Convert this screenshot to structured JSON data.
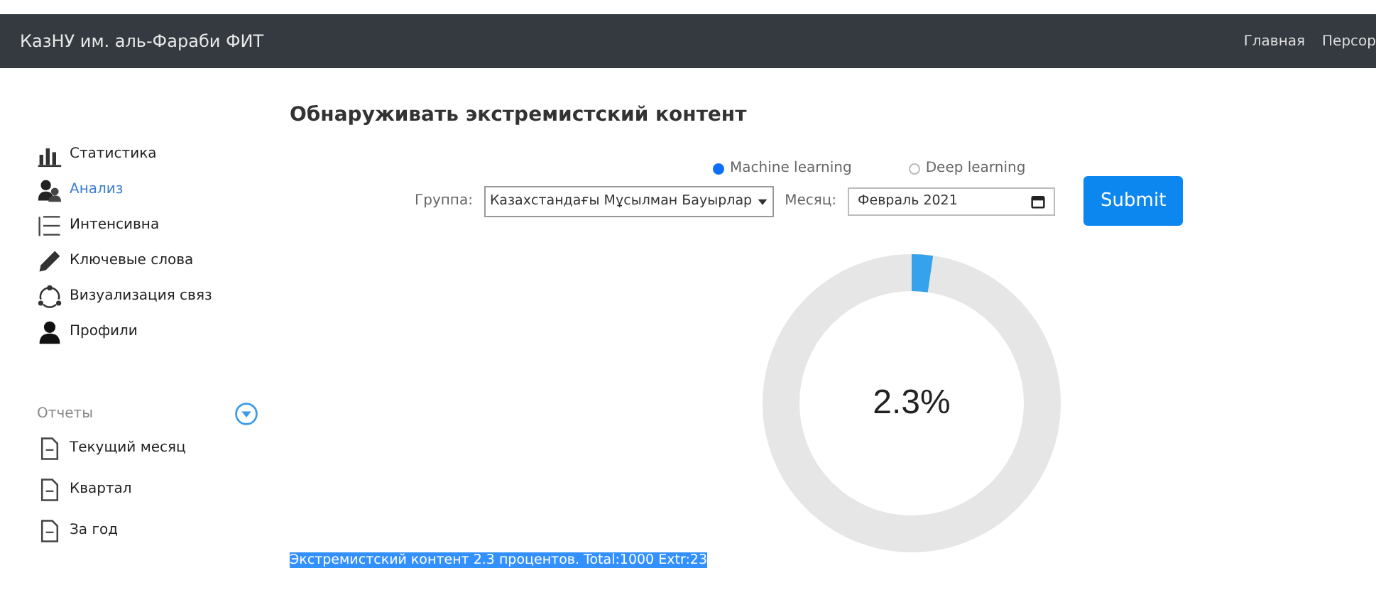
{
  "navbar": {
    "brand": "КазНУ им. аль-Фараби ФИТ",
    "links": [
      "Главная",
      "Персор"
    ]
  },
  "sidebar": {
    "items": [
      {
        "label": "Статистика",
        "selected": false
      },
      {
        "label": "Анализ",
        "selected": true
      },
      {
        "label": "Интенсивна",
        "selected": false
      },
      {
        "label": "Ключевые слова",
        "selected": false
      },
      {
        "label": "Визуализация связ",
        "selected": false
      },
      {
        "label": "Профили",
        "selected": false
      }
    ],
    "reports": {
      "title": "Отчеты",
      "expanded": true,
      "items": [
        {
          "label": "Текущий месяц"
        },
        {
          "label": "Квартал"
        },
        {
          "label": "За год"
        }
      ]
    }
  },
  "main": {
    "title": "Обнаруживать экстремистский контент",
    "methods": [
      {
        "label": "Machine learning",
        "selected": true
      },
      {
        "label": "Deep learning",
        "selected": false
      }
    ],
    "group_label": "Группа:",
    "group_value": "Казахстандағы Мұсылман Бауырлар",
    "month_label": "Месяц:",
    "month_value": "Февраль 2021",
    "submit": "Submit",
    "gauge": {
      "level": 0.023,
      "label": "2.3%"
    },
    "result": "Экстремистский контент 2.3 процентов. Total:1000 Extr:23"
  }
}
